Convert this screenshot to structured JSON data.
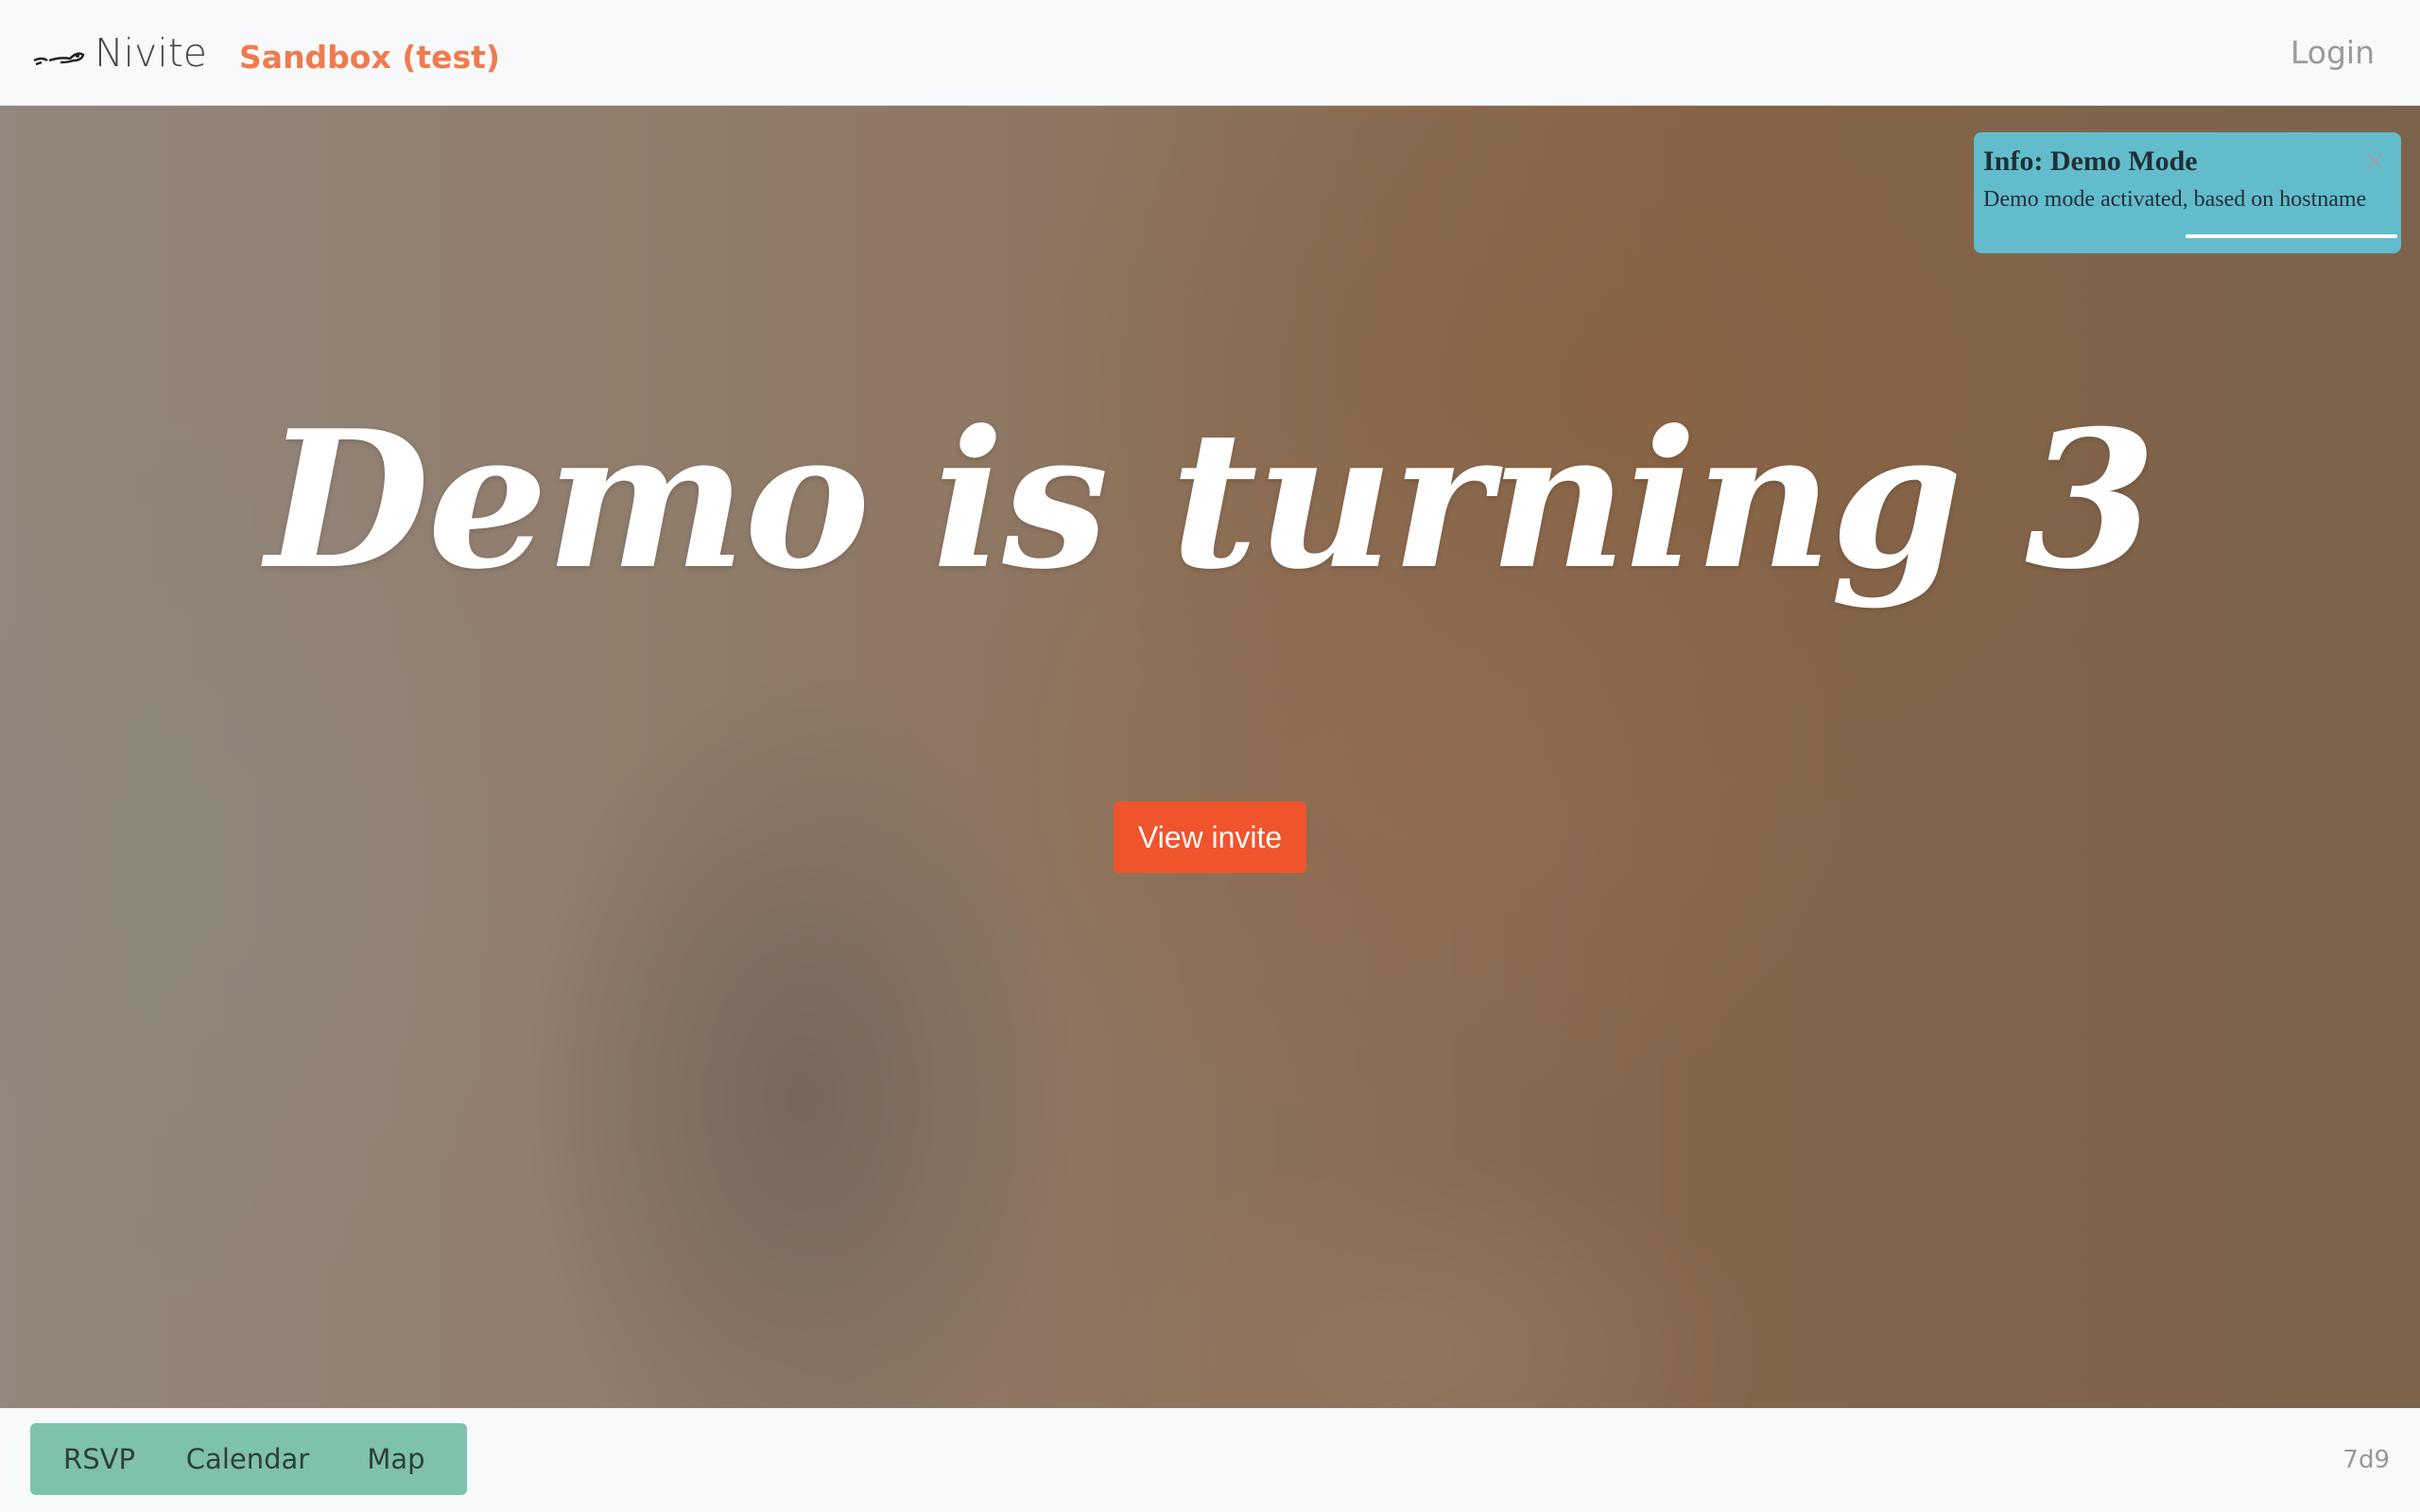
{
  "navbar": {
    "brand_name": "Nivite",
    "environment_label": "Sandbox (test)",
    "login_label": "Login"
  },
  "hero": {
    "title": "Demo is turning 3",
    "cta_label": "View invite"
  },
  "toast": {
    "title": "Info: Demo Mode",
    "message": "Demo mode activated, based on hostname"
  },
  "bottom_bar": {
    "buttons": [
      "RSVP",
      "Calendar",
      "Map"
    ],
    "version": "7d9"
  },
  "colors": {
    "accent_orange": "#f0542d",
    "sandbox_label": "#ef7b4f",
    "toast_info": "#63bccc",
    "bottom_buttons": "#7ec2aa"
  },
  "icons": [
    "nivite-logo-icon",
    "close-icon"
  ]
}
